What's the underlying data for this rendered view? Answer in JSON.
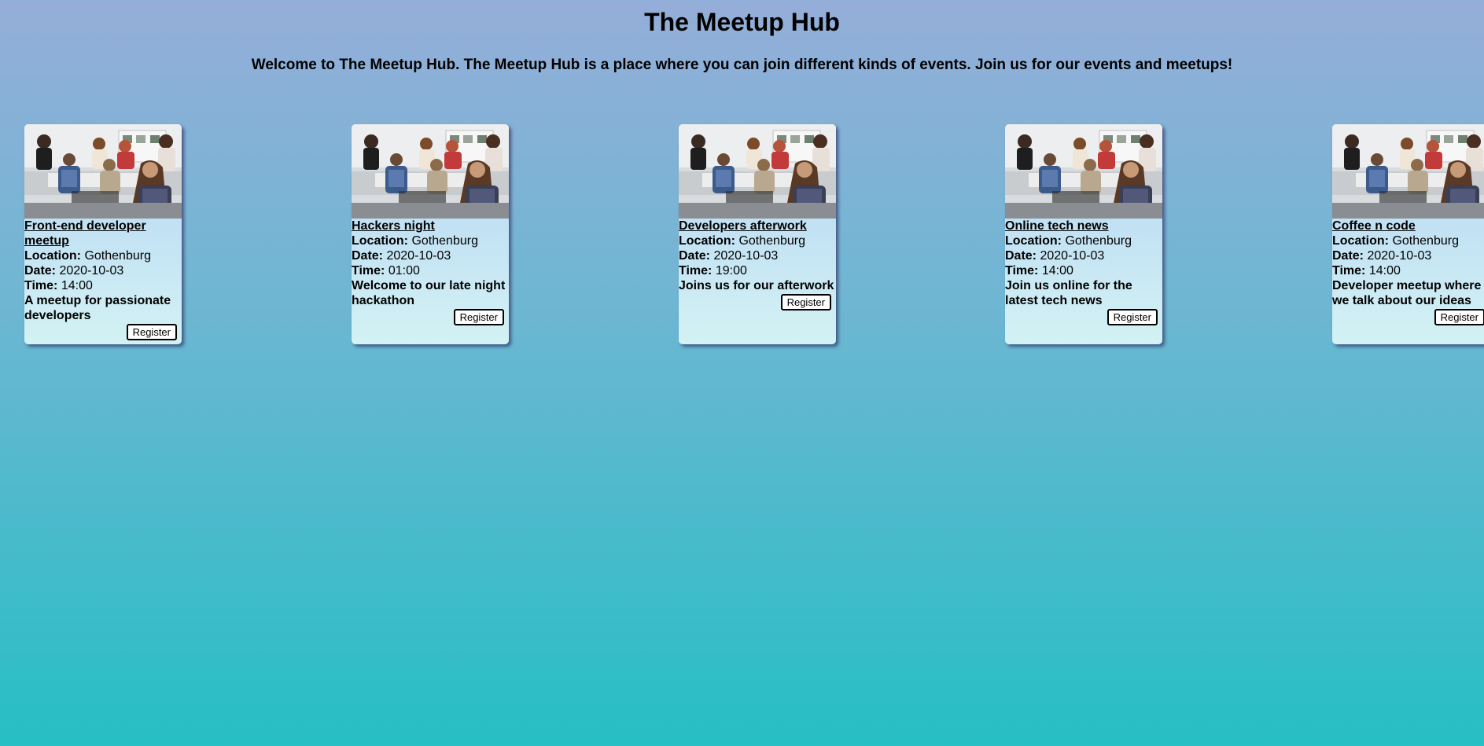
{
  "header": {
    "title": "The Meetup Hub",
    "intro": "Welcome to The Meetup Hub. The Meetup Hub is a place where you can join different kinds of events. Join us for our events and meetups!"
  },
  "labels": {
    "location": "Location:",
    "date": "Date:",
    "time": "Time:",
    "register": "Register"
  },
  "events": [
    {
      "title": "Front-end developer meetup",
      "location": "Gothenburg",
      "date": "2020-10-03",
      "time": "14:00",
      "description": "A meetup for passionate developers"
    },
    {
      "title": "Hackers night",
      "location": "Gothenburg",
      "date": "2020-10-03",
      "time": "01:00",
      "description": "Welcome to our late night hackathon"
    },
    {
      "title": "Developers afterwork",
      "location": "Gothenburg",
      "date": "2020-10-03",
      "time": "19:00",
      "description": "Joins us for our afterwork"
    },
    {
      "title": "Online tech news",
      "location": "Gothenburg",
      "date": "2020-10-03",
      "time": "14:00",
      "description": "Join us online for the latest tech news"
    },
    {
      "title": "Coffee n code",
      "location": "Gothenburg",
      "date": "2020-10-03",
      "time": "14:00",
      "description": "Developer meetup where we talk about our ideas"
    }
  ]
}
